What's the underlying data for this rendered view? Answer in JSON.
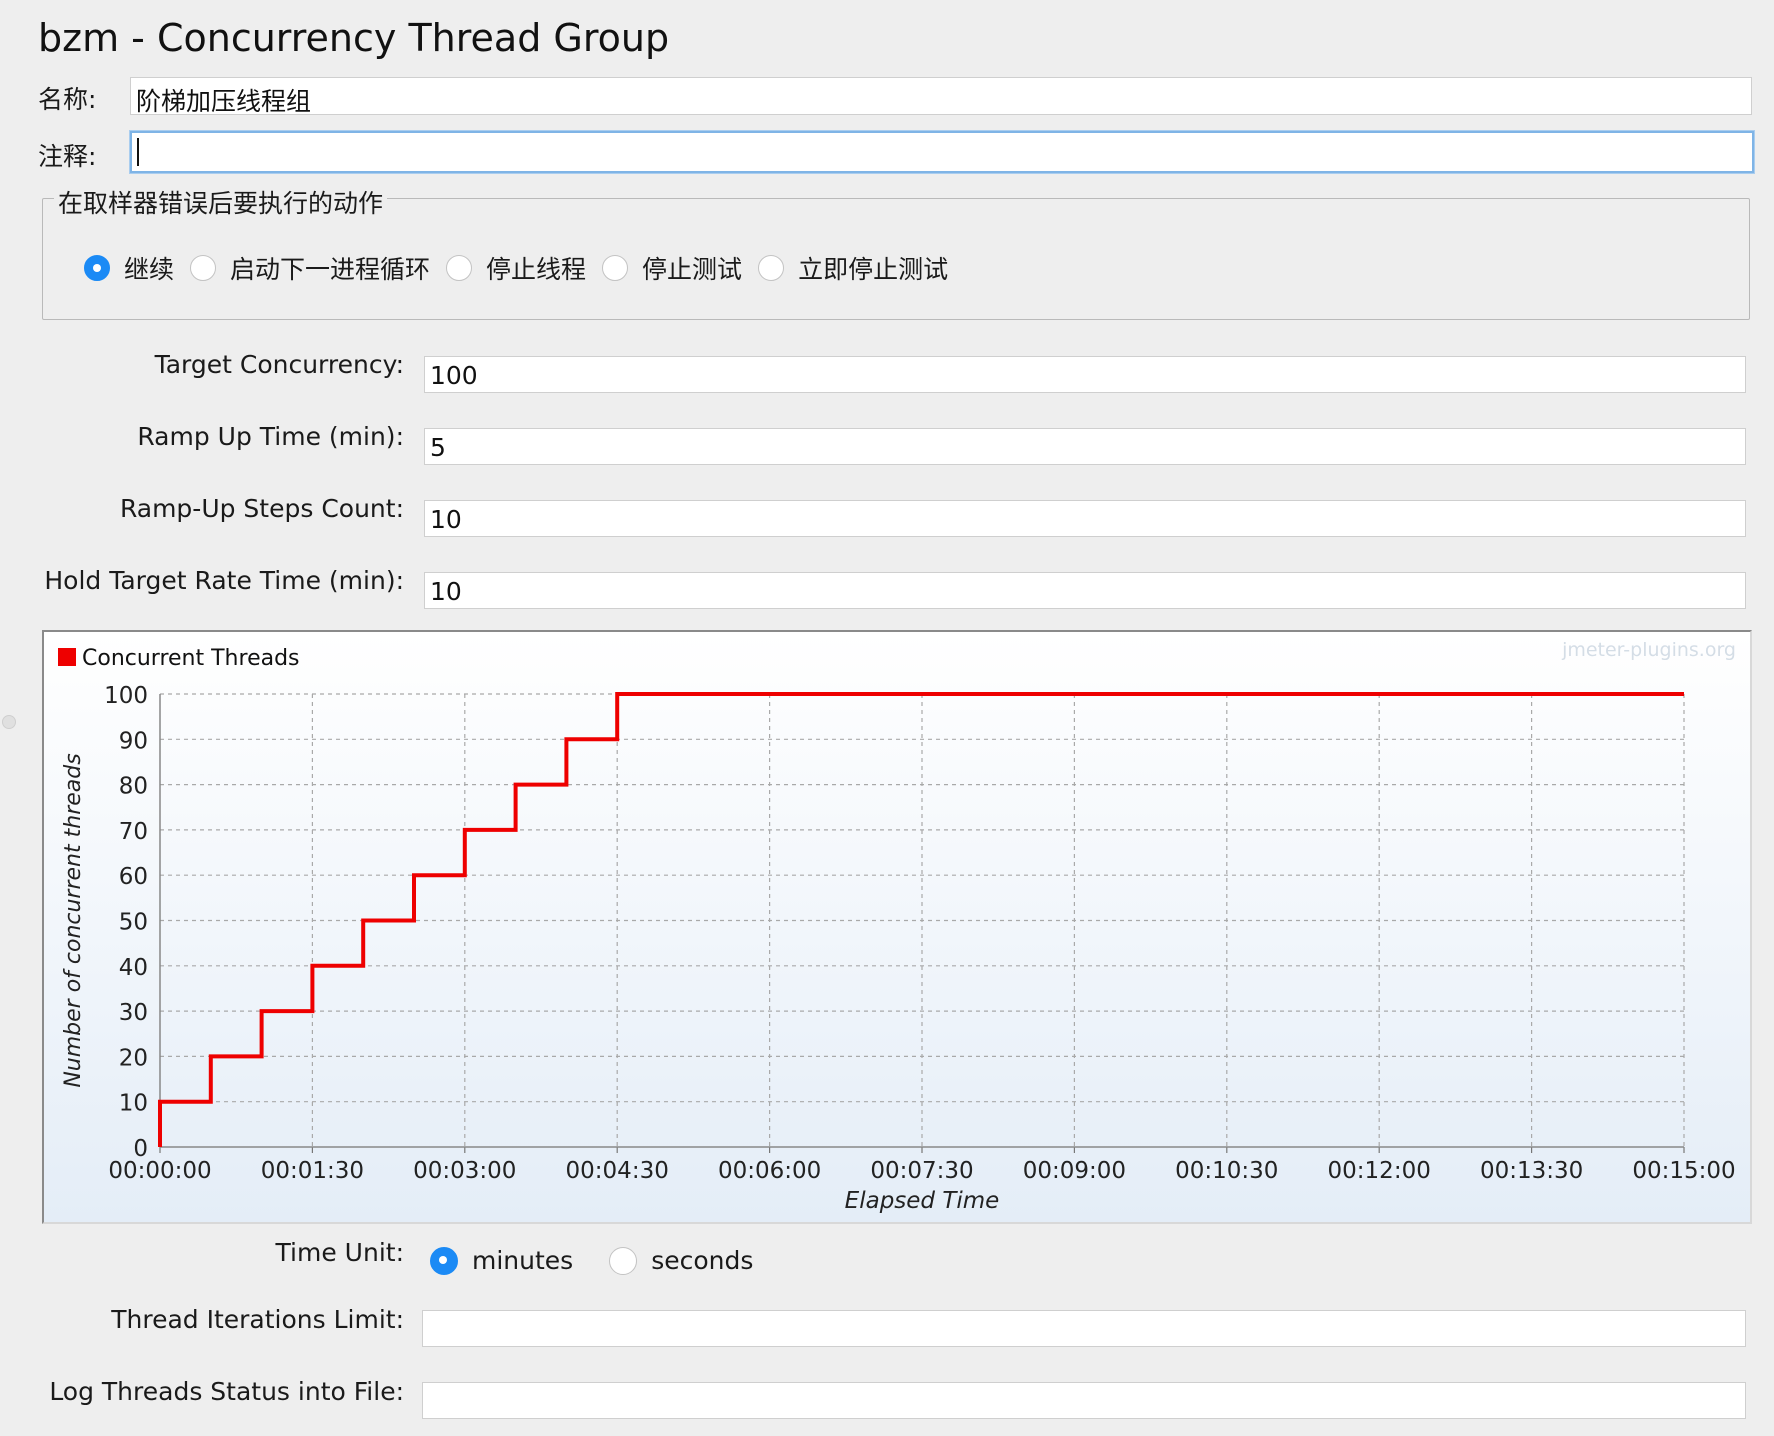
{
  "header": {
    "title": "bzm - Concurrency Thread Group"
  },
  "name": {
    "label": "名称:",
    "value": "阶梯加压线程组"
  },
  "comment": {
    "label": "注释:",
    "value": ""
  },
  "sampler_error": {
    "legend": "在取样器错误后要执行的动作",
    "options": [
      {
        "label": "继续",
        "selected": true
      },
      {
        "label": "启动下一进程循环",
        "selected": false
      },
      {
        "label": "停止线程",
        "selected": false
      },
      {
        "label": "停止测试",
        "selected": false
      },
      {
        "label": "立即停止测试",
        "selected": false
      }
    ]
  },
  "params": {
    "target_concurrency": {
      "label": "Target Concurrency:",
      "value": "100"
    },
    "ramp_up_time": {
      "label": "Ramp Up Time (min):",
      "value": "5"
    },
    "ramp_up_steps": {
      "label": "Ramp-Up Steps Count:",
      "value": "10"
    },
    "hold_time": {
      "label": "Hold Target Rate Time (min):",
      "value": "10"
    }
  },
  "chart_data": {
    "type": "line",
    "watermark": "jmeter-plugins.org",
    "xlabel": "Elapsed Time",
    "ylabel": "Number of concurrent threads",
    "ylim": [
      0,
      100
    ],
    "xlim": [
      "00:00:00",
      "00:15:00"
    ],
    "grid": true,
    "legend_position": "top-left",
    "x_ticks": [
      "00:00:00",
      "00:01:30",
      "00:03:00",
      "00:04:30",
      "00:06:00",
      "00:07:30",
      "00:09:00",
      "00:10:30",
      "00:12:00",
      "00:13:30",
      "00:15:00"
    ],
    "y_ticks": [
      0,
      10,
      20,
      30,
      40,
      50,
      60,
      70,
      80,
      90,
      100
    ],
    "series": [
      {
        "name": "Concurrent Threads",
        "color": "#ee0000",
        "step": true,
        "x": [
          "00:00:00",
          "00:00:30",
          "00:01:00",
          "00:01:30",
          "00:02:00",
          "00:02:30",
          "00:03:00",
          "00:03:30",
          "00:04:00",
          "00:04:30",
          "00:15:00"
        ],
        "y": [
          10,
          20,
          30,
          40,
          50,
          60,
          70,
          80,
          90,
          100,
          100
        ]
      }
    ]
  },
  "time_unit": {
    "label": "Time Unit:",
    "options": [
      {
        "label": "minutes",
        "selected": true
      },
      {
        "label": "seconds",
        "selected": false
      }
    ]
  },
  "iterations": {
    "label": "Thread Iterations Limit:",
    "value": ""
  },
  "log_file": {
    "label": "Log Threads Status into File:",
    "value": ""
  }
}
